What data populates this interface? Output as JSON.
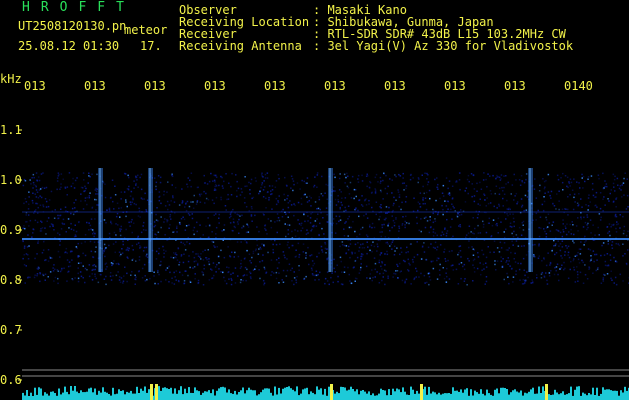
{
  "header": {
    "brand": "HROFFT",
    "filename": "UT2508120130.pn",
    "mode": "meteor",
    "datetime": "25.08.12 01:30",
    "count": "17.",
    "observer_label": "Observer",
    "observer_value": ": Masaki Kano",
    "location_label": "Receiving Location",
    "location_value": ": Shibukawa, Gunma, Japan",
    "receiver_label": "Receiver",
    "receiver_value": ": RTL-SDR SDR# 43dB L15 103.2MHz CW",
    "antenna_label": "Receiving Antenna",
    "antenna_value": ": 3el Yagi(V) Az 330 for Vladivostok"
  },
  "axis": {
    "unit": "kHz",
    "y_ticks": [
      "1.1",
      "1.0",
      "0.9",
      "0.8",
      "0.7",
      "0.6"
    ],
    "x_ticks": [
      "013",
      "013",
      "013",
      "013",
      "013",
      "013",
      "013",
      "013",
      "013",
      "0140"
    ]
  },
  "colors": {
    "background": "#000000",
    "text": "#f2f24a",
    "brand": "#29e05a",
    "signal_dark": "#0a1a8c",
    "signal_bright": "#3b8cff",
    "level_meter": "#20e0f0",
    "level_peak": "#f2f24a"
  }
}
